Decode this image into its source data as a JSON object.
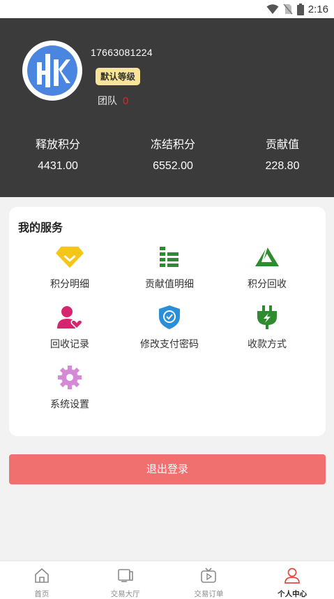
{
  "status_bar": {
    "time": "2:16"
  },
  "profile": {
    "phone": "17663081224",
    "level": "默认等级",
    "team_label": "团队",
    "team_count": "0"
  },
  "stats": [
    {
      "label": "释放积分",
      "value": "4431.00"
    },
    {
      "label": "冻结积分",
      "value": "6552.00"
    },
    {
      "label": "贡献值",
      "value": "228.80"
    }
  ],
  "services": {
    "title": "我的服务",
    "items": [
      {
        "label": "积分明细",
        "icon": "diamond-icon",
        "color": "#f5c518"
      },
      {
        "label": "贡献值明细",
        "icon": "list-icon",
        "color": "#2e8b2e"
      },
      {
        "label": "积分回收",
        "icon": "recycle-icon",
        "color": "#2e8b2e"
      },
      {
        "label": "回收记录",
        "icon": "user-heart-icon",
        "color": "#d6246e"
      },
      {
        "label": "修改支付密码",
        "icon": "shield-check-icon",
        "color": "#2a8fd8"
      },
      {
        "label": "收款方式",
        "icon": "plug-icon",
        "color": "#2e8b2e"
      },
      {
        "label": "系统设置",
        "icon": "gear-icon",
        "color": "#d58ad8"
      }
    ]
  },
  "logout_label": "退出登录",
  "tabbar": [
    {
      "label": "首页",
      "icon": "home-icon"
    },
    {
      "label": "交易大厅",
      "icon": "hall-icon"
    },
    {
      "label": "交易订单",
      "icon": "order-icon"
    },
    {
      "label": "个人中心",
      "icon": "person-icon"
    }
  ]
}
